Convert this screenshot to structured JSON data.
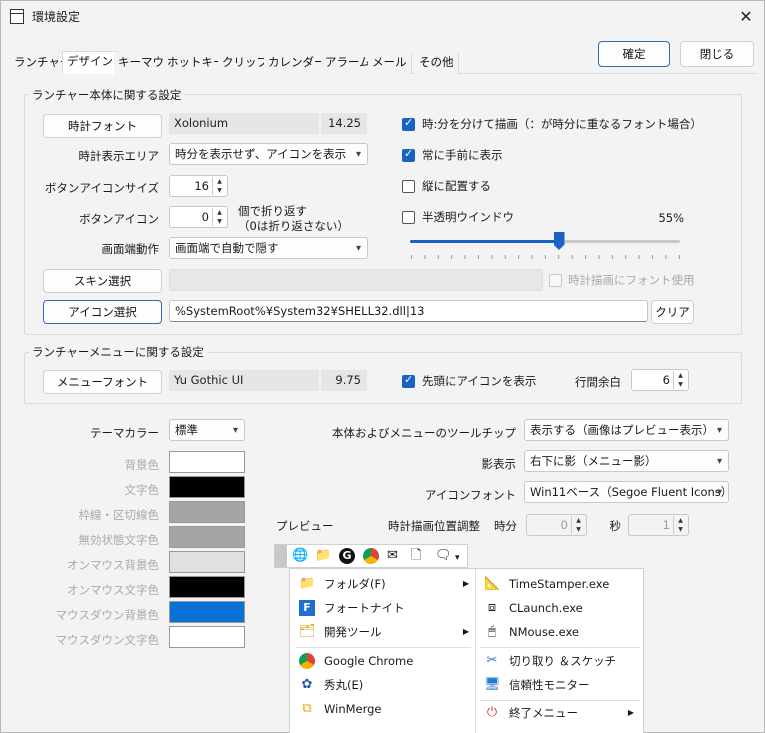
{
  "window": {
    "title": "環境設定"
  },
  "tabs": [
    "ランチャー",
    "デザイン",
    "キーマウ",
    "ホットキー",
    "クリップ",
    "カレンダー",
    "アラーム",
    "メール",
    "その他"
  ],
  "buttons": {
    "ok": "確定",
    "close": "閉じる"
  },
  "launcher_group": {
    "title": "ランチャー本体に関する設定",
    "clock_font_button": "時計フォント",
    "clock_font_name": "Xolonium",
    "clock_font_size": "14.25",
    "clock_area_label": "時計表示エリア",
    "clock_area_value": "時分を表示せず、アイコンを表示",
    "button_icon_size_label": "ボタンアイコンサイズ",
    "button_icon_size_value": "16",
    "button_icon_label": "ボタンアイコン",
    "button_icon_value": "0",
    "wrap_note_1": "個で折り返す",
    "wrap_note_2": "（0は折り返さない）",
    "edge_action_label": "画面端動作",
    "edge_action_value": "画面端で自動で隠す",
    "skin_button": "スキン選択",
    "icon_button": "アイコン選択",
    "icon_path": "%SystemRoot%¥System32¥SHELL32.dll|13",
    "clear_button": "クリア",
    "chk_split": "時:分を分けて描画（：が時分に重なるフォント場合）",
    "chk_topmost": "常に手前に表示",
    "chk_vertical": "縦に配置する",
    "chk_translucent": "半透明ウインドウ",
    "translucent_value": "55%",
    "translucent_level": 0.55,
    "chk_clock_font": "時計描画にフォント使用"
  },
  "menu_group": {
    "title": "ランチャーメニューに関する設定",
    "menu_font_button": "メニューフォント",
    "menu_font_name": "Yu Gothic UI",
    "menu_font_size": "9.75",
    "chk_icon_first": "先頭にアイコンを表示",
    "line_spacing_label": "行間余白",
    "line_spacing_value": "6"
  },
  "theme": {
    "label": "テーマカラー",
    "value": "標準",
    "colors": [
      {
        "label": "背景色",
        "hex": "#ffffff"
      },
      {
        "label": "文字色",
        "hex": "#000000"
      },
      {
        "label": "枠線・区切線色",
        "hex": "#a5a5a5"
      },
      {
        "label": "無効状態文字色",
        "hex": "#a5a5a5"
      },
      {
        "label": "オンマウス背景色",
        "hex": "#e0e0e0"
      },
      {
        "label": "オンマウス文字色",
        "hex": "#000000"
      },
      {
        "label": "マウスダウン背景色",
        "hex": "#0a72d4"
      },
      {
        "label": "マウスダウン文字色",
        "hex": "#ffffff"
      }
    ]
  },
  "tooltip": {
    "label": "本体およびメニューのツールチップ",
    "value": "表示する（画像はプレビュー表示）"
  },
  "shadow": {
    "label": "影表示",
    "value": "右下に影（メニュー影）"
  },
  "icon_font": {
    "label": "アイコンフォント",
    "value": "Win11ベース（Segoe Fluent Icons）"
  },
  "preview": {
    "label": "プレビュー",
    "clock_adjust_label": "時計描画位置調整",
    "hour_label": "時分",
    "hour_value": "0",
    "sec_label": "秒",
    "sec_value": "1"
  },
  "preview_menu": {
    "left": [
      {
        "label": "フォルダ(F)",
        "icon": "folder-icon",
        "sub": true
      },
      {
        "label": "フォートナイト",
        "icon": "fortnite-icon",
        "sub": false
      },
      {
        "label": "開発ツール",
        "icon": "dev-folder-icon",
        "sub": true
      },
      {
        "label": "Google Chrome",
        "icon": "chrome-icon",
        "sub": false
      },
      {
        "label": "秀丸(E)",
        "icon": "hidemaru-icon",
        "sub": false
      },
      {
        "label": "WinMerge",
        "icon": "winmerge-icon",
        "sub": false
      }
    ],
    "right": [
      {
        "label": "TimeStamper.exe",
        "icon": "timestamper-icon",
        "sub": false
      },
      {
        "label": "CLaunch.exe",
        "icon": "clipboard-icon",
        "sub": false
      },
      {
        "label": "NMouse.exe",
        "icon": "mouse-icon",
        "sub": false
      },
      {
        "label": "切り取り ＆スケッチ",
        "icon": "snip-icon",
        "sub": false
      },
      {
        "label": "信頼性モニター",
        "icon": "monitor-icon",
        "sub": false
      },
      {
        "label": "終了メニュー",
        "icon": "power-icon",
        "sub": true
      }
    ]
  }
}
